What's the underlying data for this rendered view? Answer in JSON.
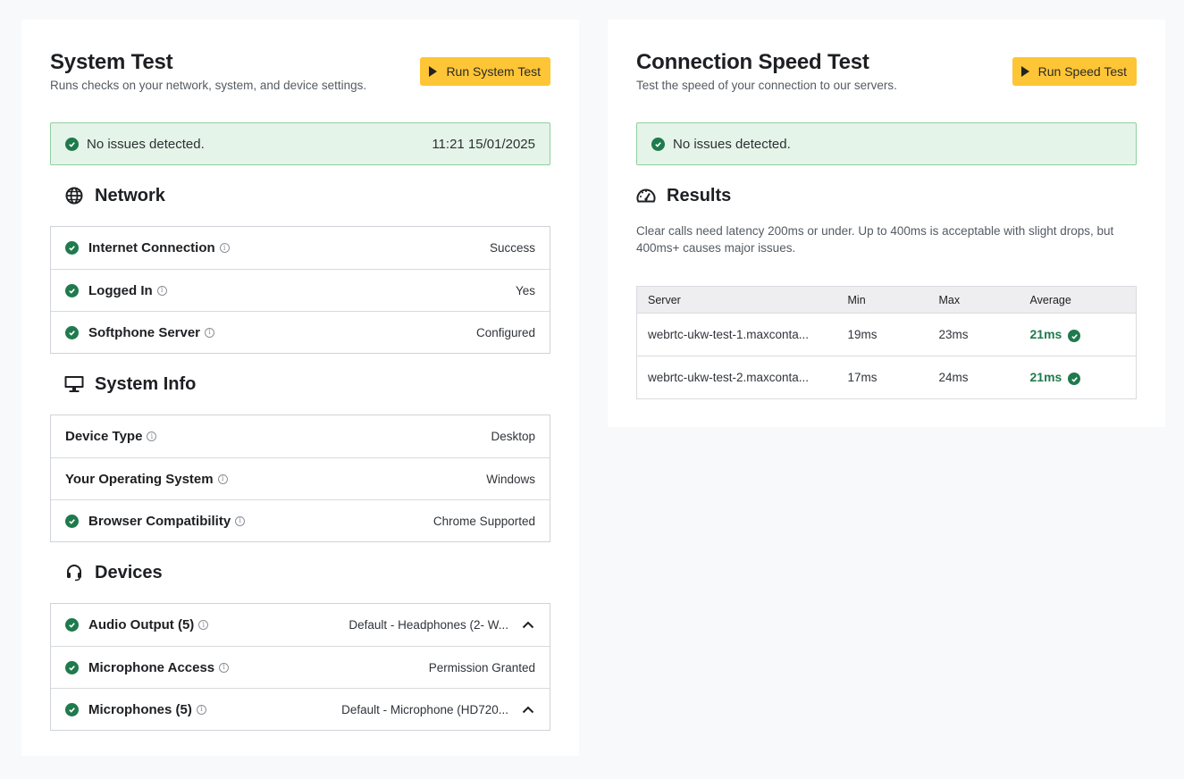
{
  "colors": {
    "accent_button": "#fec536",
    "success_green": "#1f7a4d",
    "success_bg": "#e5f4e8",
    "success_border": "#8fd0a0"
  },
  "system_test": {
    "title": "System Test",
    "subtitle": "Runs checks on your network, system, and device settings.",
    "run_button": "Run System Test",
    "status_text": "No issues detected.",
    "status_timestamp": "11:21 15/01/2025",
    "sections": [
      {
        "title": "Network",
        "icon": "globe-icon",
        "rows": [
          {
            "label": "Internet Connection",
            "value": "Success",
            "check": true
          },
          {
            "label": "Logged In",
            "value": "Yes",
            "check": true
          },
          {
            "label": "Softphone Server",
            "value": "Configured",
            "check": true
          }
        ]
      },
      {
        "title": "System Info",
        "icon": "monitor-icon",
        "rows": [
          {
            "label": "Device Type",
            "value": "Desktop",
            "check": false
          },
          {
            "label": "Your Operating System",
            "value": "Windows",
            "check": false
          },
          {
            "label": "Browser Compatibility",
            "value": "Chrome Supported",
            "check": true
          }
        ]
      },
      {
        "title": "Devices",
        "icon": "headset-icon",
        "rows": [
          {
            "label": "Audio Output (5)",
            "value": "Default - Headphones (2- W...",
            "check": true,
            "expand": true
          },
          {
            "label": "Microphone Access",
            "value": "Permission Granted",
            "check": true
          },
          {
            "label": "Microphones (5)",
            "value": "Default - Microphone (HD720...",
            "check": true,
            "expand": true
          }
        ]
      }
    ]
  },
  "speed_test": {
    "title": "Connection Speed Test",
    "subtitle": "Test the speed of your connection to our servers.",
    "run_button": "Run Speed Test",
    "status_text": "No issues detected.",
    "results_title": "Results",
    "results_description": "Clear calls need latency 200ms or under. Up to 400ms is acceptable with slight drops, but 400ms+ causes major issues.",
    "table": {
      "columns": [
        "Server",
        "Min",
        "Max",
        "Average"
      ],
      "rows": [
        {
          "server": "webrtc-ukw-test-1.maxconta...",
          "min": "19ms",
          "max": "23ms",
          "average": "21ms"
        },
        {
          "server": "webrtc-ukw-test-2.maxconta...",
          "min": "17ms",
          "max": "24ms",
          "average": "21ms"
        }
      ]
    }
  }
}
